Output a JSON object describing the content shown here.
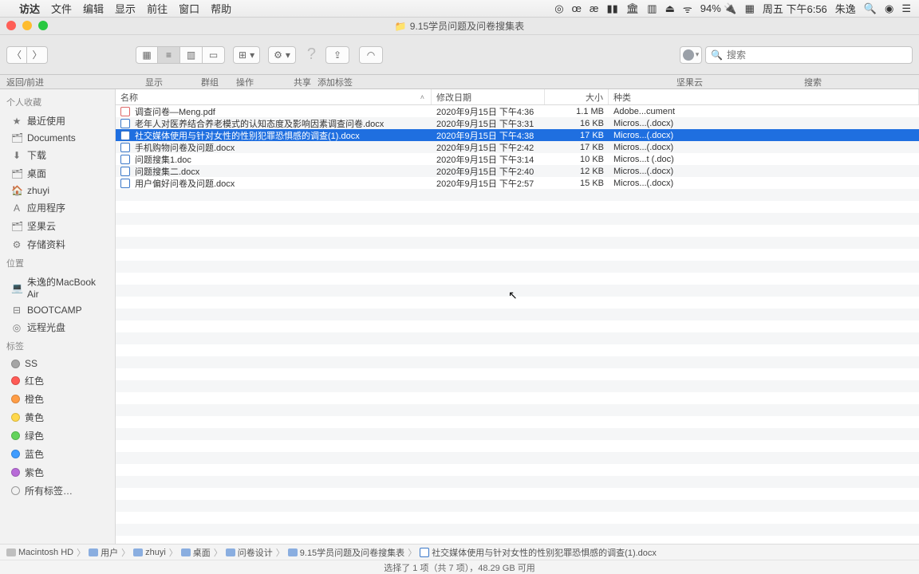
{
  "menubar": {
    "apple": "",
    "app": "访达",
    "items": [
      "文件",
      "编辑",
      "显示",
      "前往",
      "窗口",
      "帮助"
    ],
    "right": {
      "icons": [
        "◎",
        "œ",
        "æ",
        "▮▮",
        "🏛",
        "▥",
        "⏏",
        "ᯤ"
      ],
      "battery": "94% 🔌",
      "cal": "▦",
      "datetime": "周五 下午6:56",
      "user": "朱逸",
      "spotlight": "🔍",
      "siri": "◉",
      "nc": "☰"
    }
  },
  "window": {
    "title": "9.15学员问题及问卷搜集表",
    "nav_label": "返回/前进",
    "labels": {
      "view": "显示",
      "group": "群组",
      "action": "操作",
      "share": "共享",
      "tags": "添加标签",
      "cloud": "坚果云",
      "search": "搜索"
    },
    "search_placeholder": "搜索"
  },
  "sidebar": {
    "sec1": "个人收藏",
    "fav": [
      {
        "icon": "★",
        "label": "最近使用"
      },
      {
        "icon": "🗂",
        "label": "Documents"
      },
      {
        "icon": "⬇",
        "label": "下载"
      },
      {
        "icon": "🗂",
        "label": "桌面"
      },
      {
        "icon": "🏠",
        "label": "zhuyi"
      },
      {
        "icon": "A",
        "label": "应用程序"
      },
      {
        "icon": "🗂",
        "label": "坚果云"
      },
      {
        "icon": "⚙",
        "label": "存储资料"
      }
    ],
    "sec2": "位置",
    "loc": [
      {
        "icon": "💻",
        "label": "朱逸的MacBook Air"
      },
      {
        "icon": "⊟",
        "label": "BOOTCAMP"
      },
      {
        "icon": "◎",
        "label": "远程光盘"
      }
    ],
    "sec3": "标签",
    "tags": [
      {
        "color": "#a5a5a5",
        "label": "SS"
      },
      {
        "color": "#ff5b56",
        "label": "红色"
      },
      {
        "color": "#ff9d46",
        "label": "橙色"
      },
      {
        "color": "#ffd84c",
        "label": "黄色"
      },
      {
        "color": "#63d35b",
        "label": "绿色"
      },
      {
        "color": "#3e9cff",
        "label": "蓝色"
      },
      {
        "color": "#b86bd8",
        "label": "紫色"
      },
      {
        "color": "",
        "label": "所有标签…",
        "ring": true
      }
    ]
  },
  "columns": {
    "name": "名称",
    "date": "修改日期",
    "size": "大小",
    "kind": "种类"
  },
  "files": [
    {
      "icon": "pdf",
      "name": "调查问卷—Meng.pdf",
      "date": "2020年9月15日 下午4:36",
      "size": "1.1 MB",
      "kind": "Adobe...cument",
      "sel": false
    },
    {
      "icon": "doc",
      "name": "老年人对医养结合养老模式的认知态度及影响因素调查问卷.docx",
      "date": "2020年9月15日 下午3:31",
      "size": "16 KB",
      "kind": "Micros...(.docx)",
      "sel": false
    },
    {
      "icon": "doc",
      "name": "社交媒体使用与针对女性的性别犯罪恐惧感的调查(1).docx",
      "date": "2020年9月15日 下午4:38",
      "size": "17 KB",
      "kind": "Micros...(.docx)",
      "sel": true
    },
    {
      "icon": "doc",
      "name": "手机购物问卷及问题.docx",
      "date": "2020年9月15日 下午2:42",
      "size": "17 KB",
      "kind": "Micros...(.docx)",
      "sel": false
    },
    {
      "icon": "doc",
      "name": "问题搜集1.doc",
      "date": "2020年9月15日 下午3:14",
      "size": "10 KB",
      "kind": "Micros...t (.doc)",
      "sel": false
    },
    {
      "icon": "doc",
      "name": "问题搜集二.docx",
      "date": "2020年9月15日 下午2:40",
      "size": "12 KB",
      "kind": "Micros...(.docx)",
      "sel": false
    },
    {
      "icon": "doc",
      "name": "用户偏好问卷及问题.docx",
      "date": "2020年9月15日 下午2:57",
      "size": "15 KB",
      "kind": "Micros...(.docx)",
      "sel": false
    }
  ],
  "path": [
    "Macintosh HD",
    "用户",
    "zhuyi",
    "桌面",
    "问卷设计",
    "9.15学员问题及问卷搜集表",
    "社交媒体使用与针对女性的性别犯罪恐惧感的调查(1).docx"
  ],
  "status": "选择了 1 项（共 7 项），48.29 GB 可用"
}
